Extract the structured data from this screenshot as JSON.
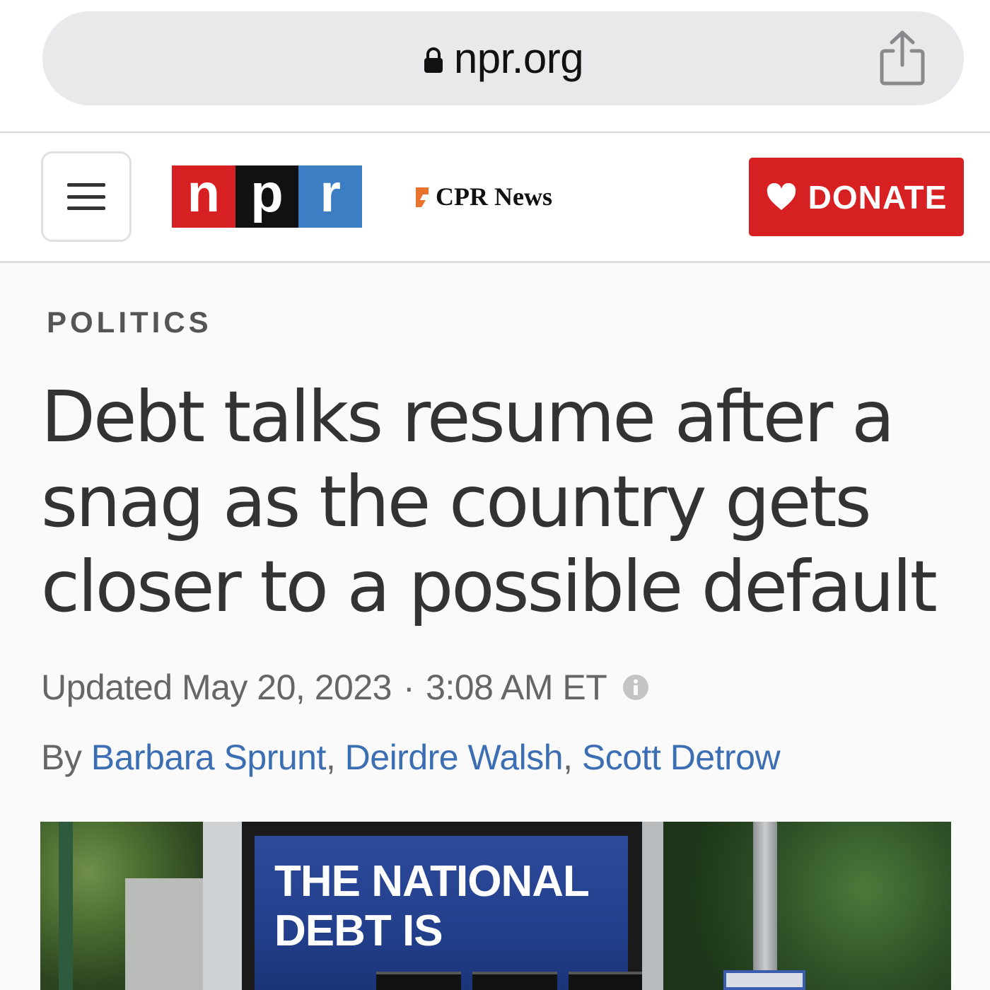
{
  "browser": {
    "url": "npr.org"
  },
  "header": {
    "logo_letters": [
      "n",
      "p",
      "r"
    ],
    "partner": "CPR News",
    "donate_label": "DONATE"
  },
  "colors": {
    "npr_red": "#d62021",
    "npr_black": "#111111",
    "npr_blue": "#3c7dc3",
    "link_blue": "#3c6eb4",
    "cpr_orange": "#e8732c"
  },
  "article": {
    "section": "POLITICS",
    "headline": "Debt talks resume after a snag as the country gets closer to a possible default",
    "updated_label": "Updated",
    "date": "May 20, 2023",
    "separator": "·",
    "time": "3:08 AM ET",
    "by_label": "By",
    "authors": [
      "Barbara Sprunt",
      "Deirdre Walsh",
      "Scott Detrow"
    ],
    "author_separator": ", "
  },
  "photo": {
    "sign_text_line1": "THE NATIONAL",
    "sign_text_line2": "DEBT IS"
  },
  "icons": {
    "lock": "lock-icon",
    "share": "share-icon",
    "menu": "hamburger-menu-icon",
    "heart": "heart-icon",
    "info": "info-icon"
  }
}
